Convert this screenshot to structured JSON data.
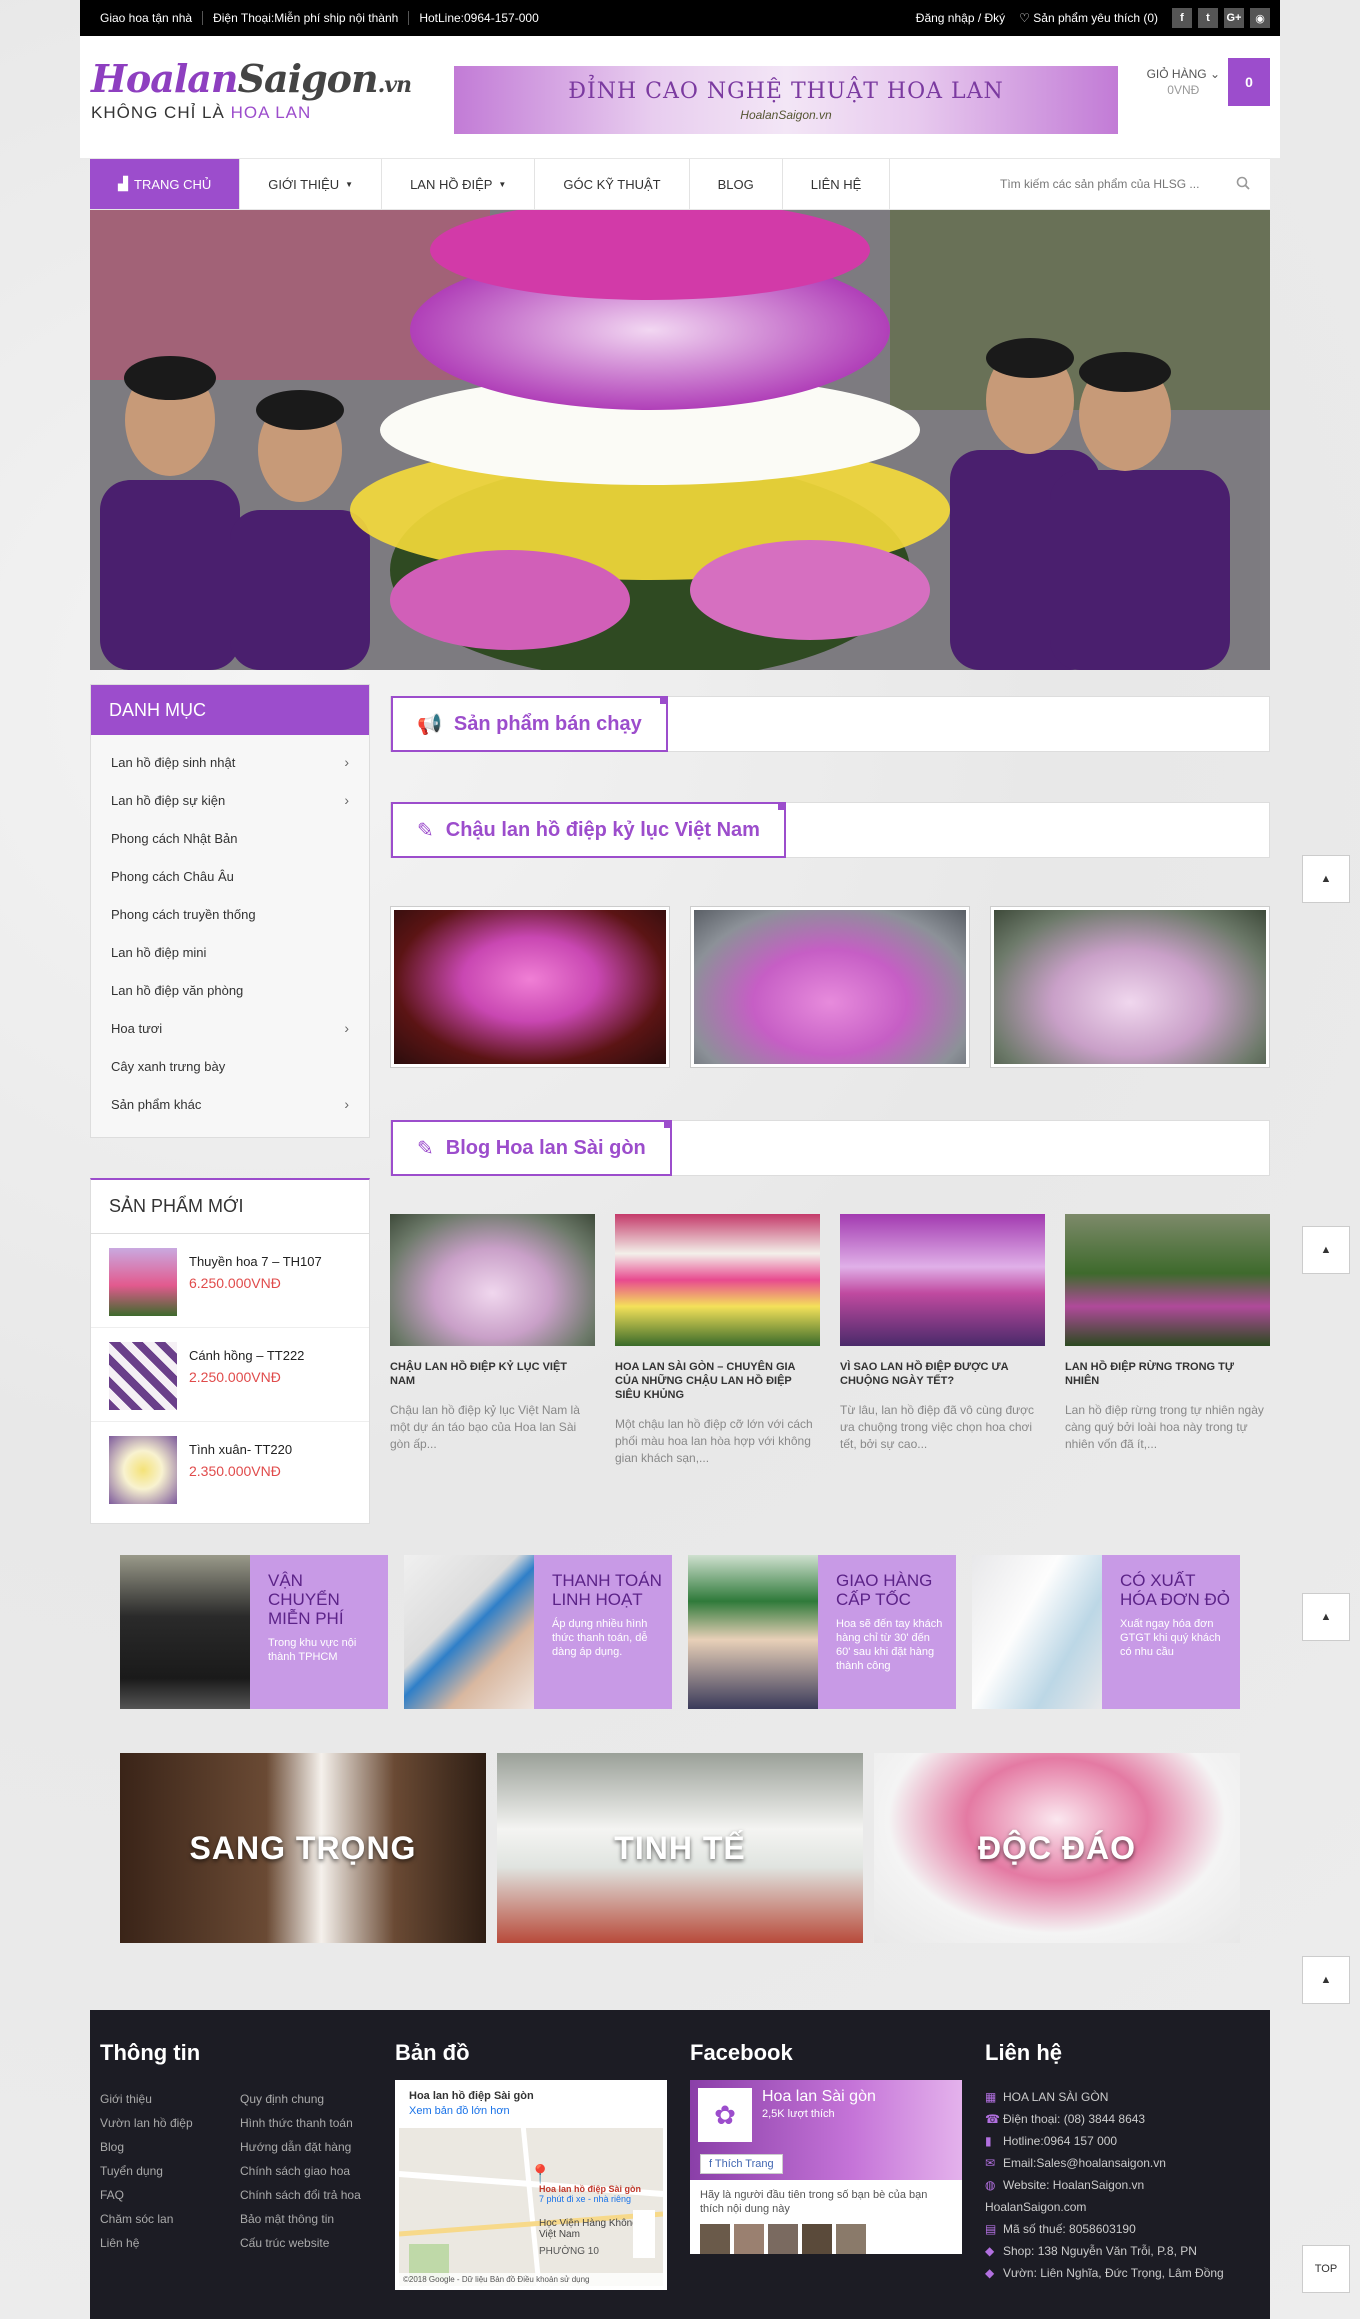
{
  "topbar": {
    "items": [
      "Giao hoa tận nhà",
      "Điện Thoại:Miễn phí ship nội thành",
      "HotLine:0964-157-000"
    ],
    "login": "Đăng nhập / Đký",
    "wishlist": "Sản phẩm yêu thích (0)",
    "social": [
      "f",
      "t",
      "G+",
      "rss"
    ]
  },
  "header": {
    "logo_main": "Hoalan",
    "logo_brand": "Saigon",
    "logo_tld": ".vn",
    "tagline_1": "KHÔNG CHỈ LÀ",
    "tagline_2": "HOA LAN",
    "banner_title": "ĐỈNH CAO NGHỆ THUẬT HOA LAN",
    "banner_sub": "HoalanSaigon.vn",
    "cart_label": "GIỎ HÀNG",
    "cart_value": "0VNĐ",
    "cart_count": "0"
  },
  "nav": {
    "items": [
      {
        "label": "TRANG CHỦ"
      },
      {
        "label": "GIỚI THIỆU"
      },
      {
        "label": "LAN HỒ ĐIỆP"
      },
      {
        "label": "GÓC KỸ THUẬT"
      },
      {
        "label": "BLOG"
      },
      {
        "label": "LIÊN HỆ"
      }
    ],
    "search_placeholder": "Tìm kiếm các sản phẩm của HLSG ..."
  },
  "sidebar": {
    "category_title": "DANH MỤC",
    "categories": [
      "Lan hồ điệp sinh nhật",
      "Lan hồ điệp sự kiện",
      "Phong cách Nhật Bản",
      "Phong cách Châu Âu",
      "Phong cách truyền thống",
      "Lan hồ điệp mini",
      "Lan hồ điệp văn phòng",
      "Hoa tươi",
      "Cây xanh trưng bày",
      "Sản phẩm khác"
    ],
    "new_title": "SẢN PHẨM MỚI",
    "new_products": [
      {
        "name": "Thuyền hoa 7 – TH107",
        "price": "6.250.000VNĐ"
      },
      {
        "name": "Cánh hồng – TT222",
        "price": "2.250.000VNĐ"
      },
      {
        "name": "Tình xuân- TT220",
        "price": "2.350.000VNĐ"
      }
    ]
  },
  "sections": {
    "bestseller": "Sản phẩm bán chạy",
    "record": "Chậu lan hồ điệp kỷ lục Việt Nam",
    "blog": "Blog Hoa lan Sài gòn"
  },
  "blog_posts": [
    {
      "title": "CHẬU LAN HỒ ĐIỆP KỶ LỤC VIỆT NAM",
      "desc": "Chậu lan hồ điệp kỷ lục Việt Nam là một dự án táo bạo của Hoa lan Sài gòn ấp..."
    },
    {
      "title": "HOA LAN SÀI GÒN – CHUYÊN GIA CỦA NHỮNG CHẬU LAN HỒ ĐIỆP SIÊU KHỦNG",
      "desc": "Một chậu lan hồ điệp cỡ lớn với cách phối màu hoa lan hòa hợp với không gian khách sạn,..."
    },
    {
      "title": "VÌ SAO LAN HỒ ĐIỆP ĐƯỢC ƯA CHUỘNG NGÀY TẾT?",
      "desc": "Từ lâu, lan hồ điệp đã vô cùng được ưa chuộng trong việc chọn hoa chơi tết, bởi sự cao..."
    },
    {
      "title": "LAN HỒ ĐIỆP RỪNG TRONG TỰ NHIÊN",
      "desc": "Lan hồ điệp rừng trong tự nhiên ngày càng quý bởi loài hoa này trong tự nhiên vốn đã ít,..."
    }
  ],
  "features": [
    {
      "title": "VẬN CHUYỂN MIỄN PHÍ",
      "desc": "Trong khu vực nội thành TPHCM"
    },
    {
      "title": "THANH TOÁN LINH HOẠT",
      "desc": "Áp dụng nhiều hình thức thanh toán, dễ dàng áp dụng."
    },
    {
      "title": "GIAO HÀNG CẤP TỐC",
      "desc": "Hoa sẽ đến tay khách hàng chỉ từ 30' đến 60' sau khi đặt hàng thành công"
    },
    {
      "title": "CÓ XUẤT HÓA ĐƠN ĐỎ",
      "desc": "Xuất ngay hóa đơn GTGT khi quý khách có nhu cầu"
    }
  ],
  "styles": [
    "SANG TRỌNG",
    "TINH TẾ",
    "ĐỘC ĐÁO"
  ],
  "back_to_top": "TOP",
  "footer": {
    "info_title": "Thông tin",
    "info_links": [
      "Giới thiệu",
      "Quy định chung",
      "Vườn lan hồ điệp",
      "Hình thức thanh toán",
      "Blog",
      "Hướng dẫn đặt hàng",
      "Tuyển dụng",
      "Chính sách giao hoa",
      "FAQ",
      "Chính sách đổi trả hoa",
      "Chăm sóc lan",
      "Bảo mật thông tin",
      "Liên hệ",
      "Cấu trúc website"
    ],
    "map_title": "Bản đồ",
    "map_place": "Hoa lan hồ điệp Sài gòn",
    "map_link": "Xem bản đồ lớn hơn",
    "map_pin": "Hoa lan hồ điệp Sài gòn",
    "map_route": "7 phút đi xe - nhà riêng",
    "map_label_1": "Học Viện Hàng Không Việt Nam",
    "map_label_2": "PHƯỜNG 10",
    "map_copy": "©2018 Google - Dữ liệu Bản đồ   Điều khoản sử dụng",
    "fb_title": "Facebook",
    "fb_page": "Hoa lan Sài gòn",
    "fb_likes": "2,5K lượt thích",
    "fb_like_btn": "Thích Trang",
    "fb_text": "Hãy là người đầu tiên trong số bạn bè của bạn thích nội dung này",
    "contact_title": "Liên hệ",
    "contact": [
      "HOA LAN SÀI GÒN",
      "Điện thoại: (08) 3844 8643",
      "Hotline:0964 157 000",
      "Email:Sales@hoalansaigon.vn",
      "Website: HoalanSaigon.vn",
      "HoalanSaigon.com",
      "Mã số thuế: 8058603190",
      "Shop: 138 Nguyễn Văn Trỗi, P.8, PN",
      "Vườn: Liên Nghĩa, Đức Trọng, Lâm Đồng"
    ]
  }
}
